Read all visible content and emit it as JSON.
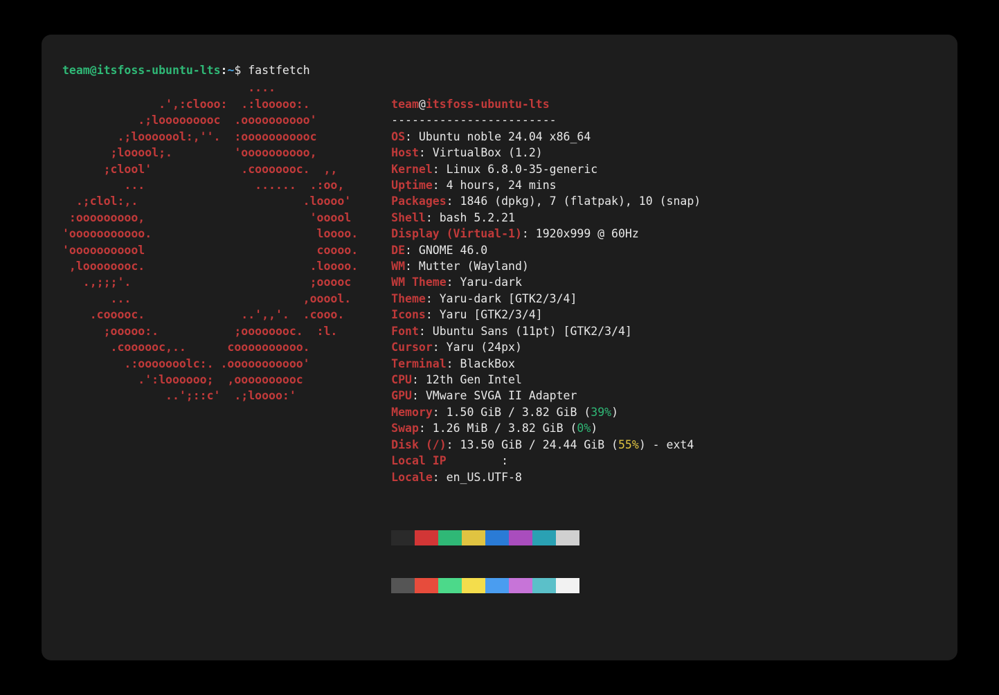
{
  "prompt": {
    "user": "team",
    "at": "@",
    "host": "itsfoss-ubuntu-lts",
    "colon": ":",
    "path": "~",
    "sigil": "$ ",
    "cmd": "fastfetch"
  },
  "title": {
    "user": "team",
    "at": "@",
    "host": "itsfoss-ubuntu-lts"
  },
  "separator": "------------------------",
  "logo_ascii": "                           ....\n              .',:clooo:  .:looooo:.\n           .;looooooooc  .oooooooooo'\n        .;looooool:,''.  :ooooooooooc\n       ;looool;.         'oooooooooo,\n      ;clool'             .cooooooc.  ,,\n         ...                ......  .:oo,\n  .;clol:,.                        .loooo'\n :ooooooooo,                        'ooool\n'ooooooooooo.                        loooo.\n'ooooooooool                         coooo.\n ,loooooooc.                        .loooo.\n   .,;;;'.                          ;ooooc\n       ...                         ,ooool.\n    .cooooc.              ..',,'.  .cooo.\n      ;ooooo:.           ;oooooooc.  :l.\n       .coooooc,..      coooooooooo.\n         .:ooooooolc:. .ooooooooooo'\n           .':loooooo;  ,oooooooooc\n               ..';::c'  .;loooo:'",
  "info": [
    {
      "key": "OS",
      "val": "Ubuntu noble 24.04 x86_64"
    },
    {
      "key": "Host",
      "val": "VirtualBox (1.2)"
    },
    {
      "key": "Kernel",
      "val": "Linux 6.8.0-35-generic"
    },
    {
      "key": "Uptime",
      "val": "4 hours, 24 mins"
    },
    {
      "key": "Packages",
      "val": "1846 (dpkg), 7 (flatpak), 10 (snap)"
    },
    {
      "key": "Shell",
      "val": "bash 5.2.21"
    },
    {
      "key": "Display (Virtual-1)",
      "val": "1920x999 @ 60Hz"
    },
    {
      "key": "DE",
      "val": "GNOME 46.0"
    },
    {
      "key": "WM",
      "val": "Mutter (Wayland)"
    },
    {
      "key": "WM Theme",
      "val": "Yaru-dark"
    },
    {
      "key": "Theme",
      "val": "Yaru-dark [GTK2/3/4]"
    },
    {
      "key": "Icons",
      "val": "Yaru [GTK2/3/4]"
    },
    {
      "key": "Font",
      "val": "Ubuntu Sans (11pt) [GTK2/3/4]"
    },
    {
      "key": "Cursor",
      "val": "Yaru (24px)"
    },
    {
      "key": "Terminal",
      "val": "BlackBox"
    },
    {
      "key": "CPU",
      "val": "12th Gen Intel"
    },
    {
      "key": "GPU",
      "val": "VMware SVGA II Adapter"
    },
    {
      "key": "Memory",
      "val": "1.50 GiB / 3.82 GiB (",
      "pct": "39%",
      "pct_class": "pct-g",
      "tail": ")"
    },
    {
      "key": "Swap",
      "val": "1.26 MiB / 3.82 GiB (",
      "pct": "0%",
      "pct_class": "pct-g",
      "tail": ")"
    },
    {
      "key": "Disk (/)",
      "val": "13.50 GiB / 24.44 GiB (",
      "pct": "55%",
      "pct_class": "pct-y",
      "tail": ") - ext4"
    },
    {
      "key": "Local IP        ",
      "val": ""
    },
    {
      "key": "Locale",
      "val": "en_US.UTF-8"
    }
  ],
  "swatches": {
    "row1": [
      "#2a2a2a",
      "#d23636",
      "#2fb876",
      "#e0c341",
      "#2a7bd6",
      "#a94dbd",
      "#2aa1b3",
      "#d0d0d0"
    ],
    "row2": [
      "#555555",
      "#e74c3c",
      "#4cd98a",
      "#f4dd4c",
      "#4a9df0",
      "#c774d8",
      "#5bc0c9",
      "#f2f2f2"
    ]
  }
}
